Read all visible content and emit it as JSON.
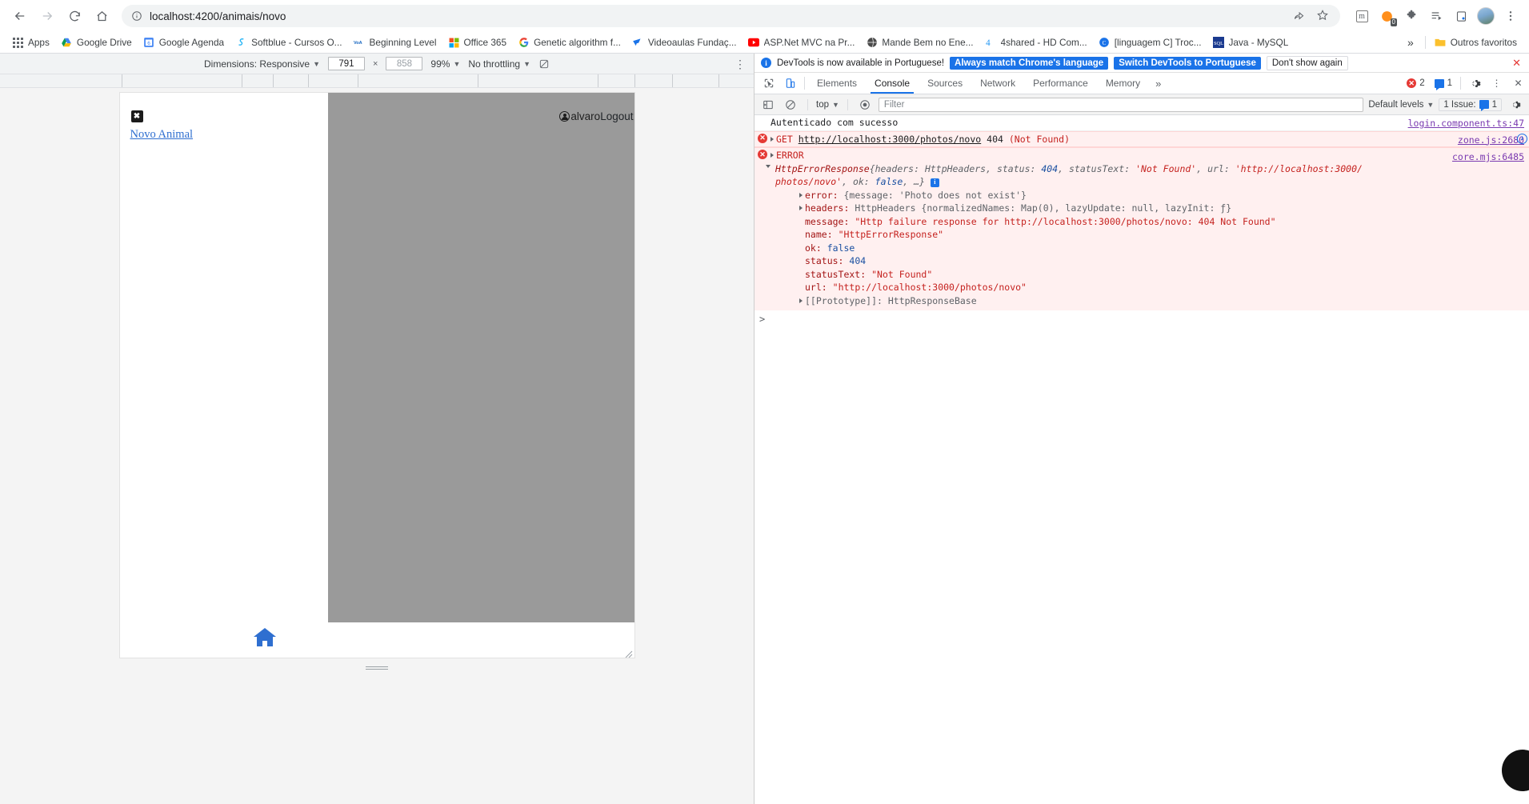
{
  "browser": {
    "url": "localhost:4200/animais/novo",
    "nav": {
      "back": "back-arrow",
      "forward": "forward-arrow",
      "reload": "reload",
      "home": "home"
    },
    "toolbar_icons": [
      "share-icon",
      "bookmark-star-icon",
      "extension-m-icon",
      "honey-extension-icon",
      "puzzle-extension-icon",
      "reading-list-icon",
      "install-app-icon",
      "profile-avatar",
      "chrome-menu-icon"
    ],
    "extension_badge": "0",
    "bookmarks": [
      {
        "label": "Apps",
        "icon": "apps-grid-icon"
      },
      {
        "label": "Google Drive",
        "icon": "drive-icon"
      },
      {
        "label": "Google Agenda",
        "icon": "calendar-icon"
      },
      {
        "label": "Softblue - Cursos O...",
        "icon": "softblue-icon"
      },
      {
        "label": "Beginning Level",
        "icon": "voa-icon"
      },
      {
        "label": "Office 365",
        "icon": "office-icon"
      },
      {
        "label": "Genetic algorithm f...",
        "icon": "google-g-icon"
      },
      {
        "label": "Videoaulas Fundaç...",
        "icon": "video-icon"
      },
      {
        "label": "ASP.Net MVC na Pr...",
        "icon": "youtube-icon"
      },
      {
        "label": "Mande Bem no Ene...",
        "icon": "globe-icon"
      },
      {
        "label": "4shared - HD Com...",
        "icon": "four-shared-icon"
      },
      {
        "label": "[linguagem C] Troc...",
        "icon": "clang-icon"
      },
      {
        "label": "Java - MySQL",
        "icon": "sql-icon"
      }
    ],
    "bookmarks_overflow": "»",
    "other_bookmarks": "Outros favoritos"
  },
  "device_toolbar": {
    "dimensions_label": "Dimensions: Responsive",
    "width": "791",
    "height": "858",
    "size_separator": "×",
    "zoom": "99%",
    "throttling": "No throttling",
    "rotate_icon": "rotate-icon",
    "more_icon": "more-vertical-icon"
  },
  "page": {
    "close_button": "✖",
    "new_animal_link": "Novo Animal",
    "username": "alvaro",
    "logout": "Logout",
    "home_icon": "home-icon"
  },
  "devtools": {
    "notification": {
      "icon": "info-icon",
      "text": "DevTools is now available in Portuguese!",
      "primary_button": "Always match Chrome's language",
      "secondary_button": "Switch DevTools to Portuguese",
      "tertiary_button": "Don't show again",
      "close": "✕"
    },
    "tabs": [
      {
        "label": "Elements",
        "selected": false
      },
      {
        "label": "Console",
        "selected": true
      },
      {
        "label": "Sources",
        "selected": false
      },
      {
        "label": "Network",
        "selected": false
      },
      {
        "label": "Performance",
        "selected": false
      },
      {
        "label": "Memory",
        "selected": false
      }
    ],
    "tabs_overflow": "»",
    "error_count": "2",
    "message_count": "1",
    "settings_icon": "gear-icon",
    "kebab_icon": "more-vertical-icon",
    "close_icon": "close-icon",
    "console_toolbar": {
      "clear_icon": "clear-console-icon",
      "no_entry_icon": "no-entry-icon",
      "context": "top",
      "eye_icon": "live-expression-icon",
      "filter_placeholder": "Filter",
      "levels": "Default levels",
      "issues": "1 Issue:",
      "issues_count": "1",
      "settings_icon": "gear-icon"
    },
    "messages": [
      {
        "type": "log",
        "text": "Autenticado com sucesso",
        "source": "login.component.ts:47"
      },
      {
        "type": "error",
        "method": "GET",
        "url": "http://localhost:3000/photos/novo",
        "status": "404",
        "status_text": "(Not Found)",
        "source": "zone.js:2680"
      },
      {
        "type": "error",
        "text": "ERROR",
        "source": "core.mjs:6485"
      }
    ],
    "error_object": {
      "header_class": "HttpErrorResponse",
      "header_preview_1": "{headers: HttpHeaders, status: ",
      "header_status": "404",
      "header_preview_2": ", statusText: ",
      "header_status_text": "'Not Found'",
      "header_preview_3": ", url: ",
      "header_url_1": "'http://localhost:3000/",
      "header_url_2": "photos/novo'",
      "header_preview_4": ", ok: ",
      "header_ok": "false",
      "header_preview_5": ", …}",
      "properties": [
        {
          "key": "error:",
          "value": "{message: 'Photo does not exist'}",
          "expandable": true
        },
        {
          "key": "headers:",
          "value": "HttpHeaders {normalizedNames: Map(0), lazyUpdate: null, lazyInit: ƒ}",
          "expandable": true
        },
        {
          "key": "message:",
          "value": "\"Http failure response for http://localhost:3000/photos/novo: 404 Not Found\"",
          "expandable": false
        },
        {
          "key": "name:",
          "value": "\"HttpErrorResponse\"",
          "expandable": false
        },
        {
          "key": "ok:",
          "value": "false",
          "expandable": false
        },
        {
          "key": "status:",
          "value": "404",
          "expandable": false
        },
        {
          "key": "statusText:",
          "value": "\"Not Found\"",
          "expandable": false
        },
        {
          "key": "url:",
          "value": "\"http://localhost:3000/photos/novo\"",
          "expandable": false
        },
        {
          "key": "[[Prototype]]:",
          "value": "HttpResponseBase",
          "expandable": true
        }
      ]
    },
    "prompt": ">"
  },
  "colors": {
    "accent_blue": "#1a73e8",
    "error_red": "#e53935",
    "error_bg": "#fff0f0",
    "link_blue": "#2f6fd0",
    "gray_panel": "#9a9a9a"
  }
}
